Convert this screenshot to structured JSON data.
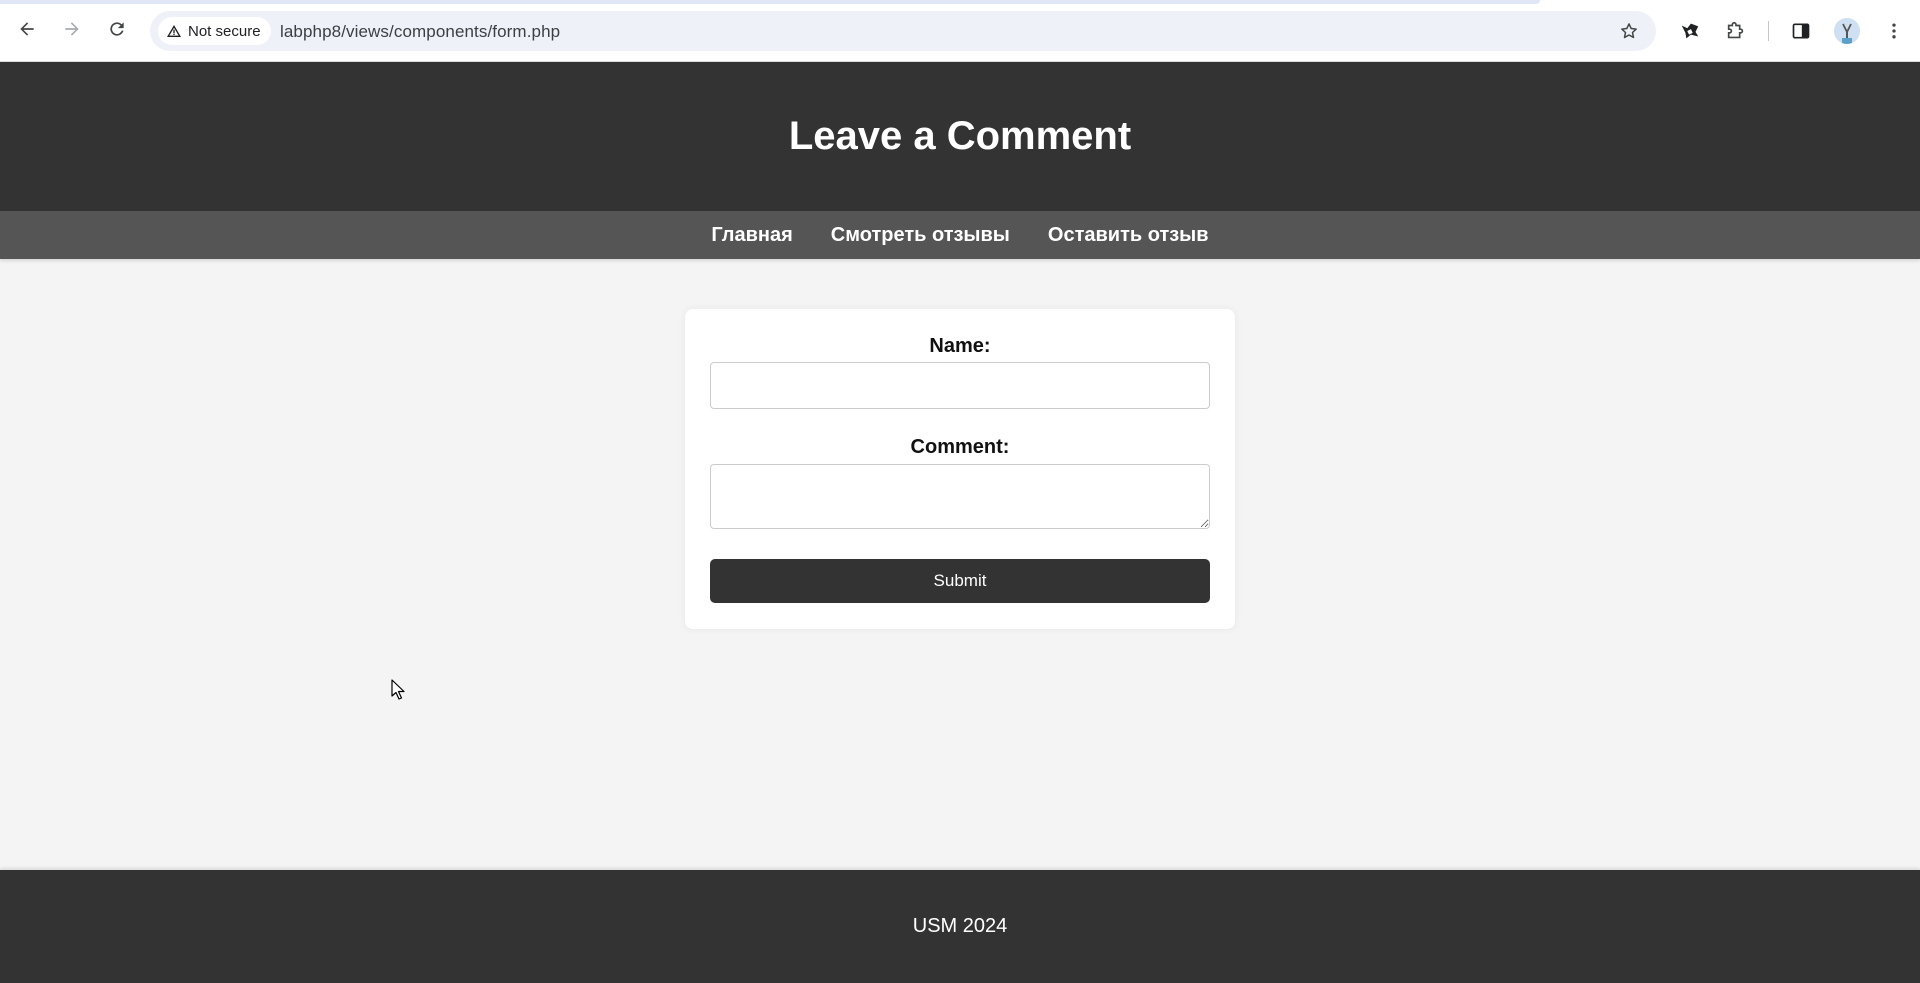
{
  "browser": {
    "security_label": "Not secure",
    "url": "labphp8/views/components/form.php",
    "icons": {
      "back": "arrow-left-icon",
      "forward": "arrow-right-icon",
      "reload": "reload-icon",
      "warning": "warning-triangle-icon",
      "bookmark": "star-icon",
      "extension_1": "extension-icon",
      "extensions": "puzzle-icon",
      "side_panel": "side-panel-icon",
      "profile": "avatar",
      "menu": "more-vert-icon"
    }
  },
  "header": {
    "title": "Leave a Comment"
  },
  "nav": {
    "items": [
      {
        "label": "Главная"
      },
      {
        "label": "Смотреть отзывы"
      },
      {
        "label": "Оставить отзыв"
      }
    ]
  },
  "form": {
    "name_label": "Name:",
    "name_value": "",
    "comment_label": "Comment:",
    "comment_value": "",
    "submit_label": "Submit"
  },
  "footer": {
    "text": "USM 2024"
  },
  "colors": {
    "header_bg": "#333333",
    "nav_bg": "#555555",
    "page_bg": "#f4f4f4",
    "button_bg": "#333333"
  }
}
